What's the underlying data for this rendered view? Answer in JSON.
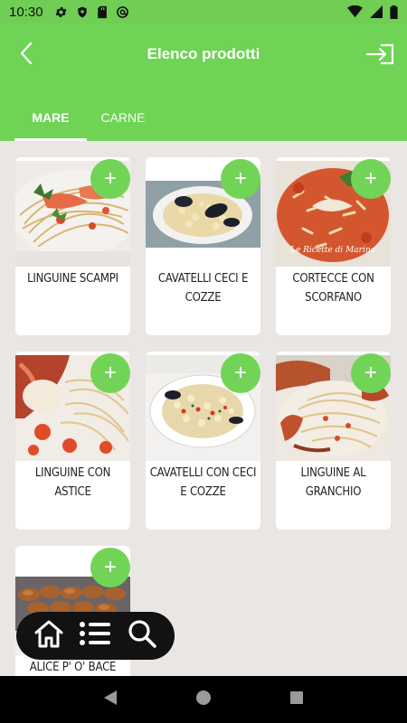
{
  "status_bar": {
    "time": "10:30",
    "icons": [
      "gear-icon",
      "shield-icon",
      "sd-card-icon",
      "at-sign-icon",
      "wifi-icon",
      "signal-icon",
      "battery-icon"
    ]
  },
  "header": {
    "title": "Elenco prodotti",
    "back_icon": "chevron-left-icon",
    "logout_icon": "logout-icon",
    "tabs": [
      {
        "label": "MARE",
        "active": true
      },
      {
        "label": "CARNE",
        "active": false
      }
    ]
  },
  "products": [
    {
      "name": "LINGUINE SCAMPI"
    },
    {
      "name": "CAVATELLI CECI E COZZE"
    },
    {
      "name": "CORTECCE CON SCORFANO"
    },
    {
      "name": "LINGUINE CON ASTICE"
    },
    {
      "name": "CAVATELLI CON CECI E COZZE"
    },
    {
      "name": "LINGUINE AL GRANCHIO"
    },
    {
      "name": "ALICE P' O' BACE"
    }
  ],
  "image_captions": {
    "cortecce_watermark": "Le Ricette di Marina"
  },
  "add_button_label": "+",
  "bottom_nav": [
    "home-icon",
    "list-icon",
    "search-icon"
  ],
  "system_nav": [
    "back-triangle-icon",
    "home-circle-icon",
    "recents-square-icon"
  ],
  "colors": {
    "accent": "#6fd356",
    "background": "#e9e6e3",
    "card": "#ffffff"
  }
}
